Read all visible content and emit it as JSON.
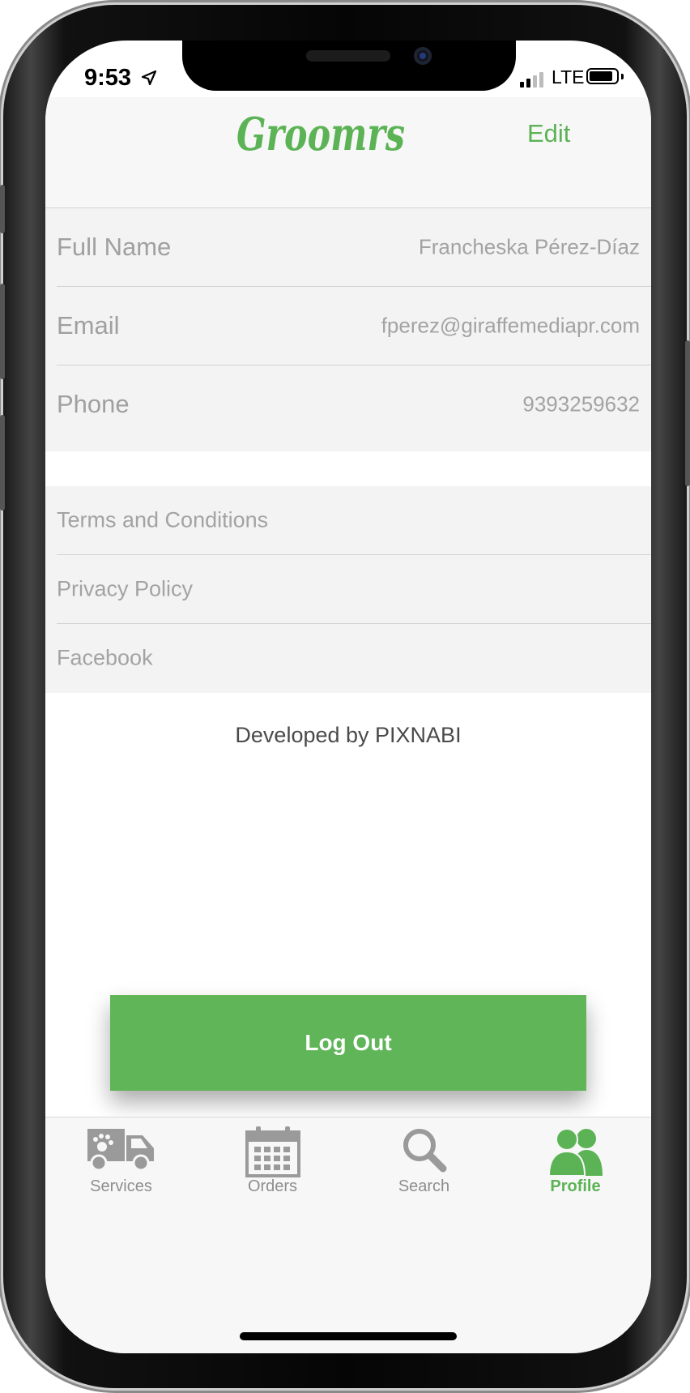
{
  "status_bar": {
    "time": "9:53",
    "network": "LTE"
  },
  "header": {
    "logo_text": "Groomrs",
    "edit_label": "Edit"
  },
  "profile": {
    "rows": [
      {
        "label": "Full Name",
        "value": "Francheska Pérez-Díaz"
      },
      {
        "label": "Email",
        "value": "fperez@giraffemediapr.com"
      },
      {
        "label": "Phone",
        "value": "9393259632"
      }
    ]
  },
  "links": {
    "items": [
      {
        "label": "Terms and Conditions"
      },
      {
        "label": "Privacy Policy"
      },
      {
        "label": "Facebook"
      }
    ]
  },
  "footer": {
    "developed_by": "Developed by PIXNABI"
  },
  "logout": {
    "label": "Log Out"
  },
  "tabbar": {
    "tabs": [
      {
        "label": "Services",
        "icon": "van-icon",
        "active": false
      },
      {
        "label": "Orders",
        "icon": "calendar-icon",
        "active": false
      },
      {
        "label": "Search",
        "icon": "search-icon",
        "active": false
      },
      {
        "label": "Profile",
        "icon": "users-icon",
        "active": true
      }
    ]
  },
  "colors": {
    "accent": "#5cb356",
    "button": "#5fb558",
    "section_bg": "#f3f3f3"
  }
}
